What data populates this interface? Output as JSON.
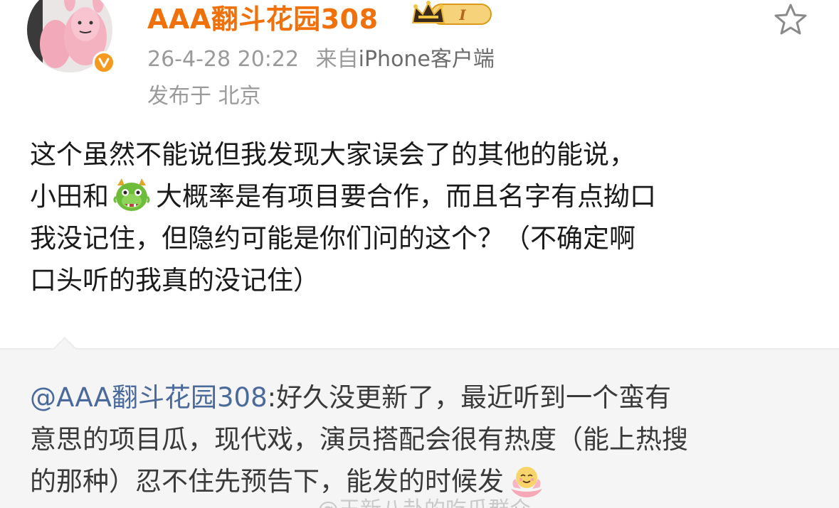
{
  "post": {
    "username": "AAA翻斗花园308",
    "badge_level": "I",
    "timestamp": "26-4-28 20:22",
    "source_prefix": "来自",
    "source_device": "iPhone客户端",
    "location": "发布于 北京",
    "content_lines": [
      "这个虽然不能说但我发现大家误会了的其他的能说，",
      "小田和",
      "大概率是有项目要合作，而且名字有点拗口",
      "我没记住，但隐约可能是你们问的这个？（不确定啊",
      "口头听的我真的没记住）"
    ]
  },
  "quoted": {
    "mention": "@AAA翻斗花园308",
    "lines": [
      ":好久没更新了，最近听到一个蛮有",
      "意思的项目瓜，现代戏，演员搭配会很有热度（能上热搜",
      "的那种）忍不住先预告下，能发的时候发"
    ]
  },
  "watermark": "@王新八卦的吃瓜群众",
  "colors": {
    "username": "#f0700a",
    "meta": "#9a9a9a",
    "text": "#1a1a1a",
    "mention": "#4a6a9c",
    "quote_bg": "#f5f5f5",
    "verified": "#f59a1f"
  },
  "icons": {
    "avatar": "pink-figure-avatar",
    "verified": "verified-v-icon",
    "crown": "crown-level-badge-icon",
    "star": "star-outline-icon",
    "dragon": "green-dragon-emoji",
    "lotus": "smiling-lotus-emoji"
  }
}
